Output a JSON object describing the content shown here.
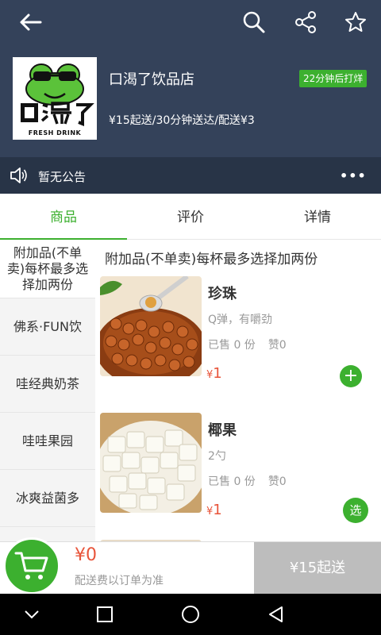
{
  "store": {
    "name": "口渴了饮品店",
    "badge": "22分钟后打烊",
    "info": "¥15起送/30分钟送达/配送¥3",
    "logo_icon": "frog-logo",
    "logo_caption": "FRESH DRINK"
  },
  "notice": {
    "text": "暂无公告",
    "more": "•••"
  },
  "tabs": [
    {
      "label": "商品",
      "active": true
    },
    {
      "label": "评价",
      "active": false
    },
    {
      "label": "详情",
      "active": false
    }
  ],
  "sidebar": {
    "items": [
      {
        "label": "附加品(不单卖)每杯最多选择加两份",
        "active": true
      },
      {
        "label": "佛系·FUN饮",
        "active": false
      },
      {
        "label": "哇经典奶茶",
        "active": false
      },
      {
        "label": "哇哇果园",
        "active": false
      },
      {
        "label": "冰爽益菌多",
        "active": false
      }
    ]
  },
  "content": {
    "category_title": "附加品(不单卖)每杯最多选择加两份",
    "products": [
      {
        "name": "珍珠",
        "desc": "Q弹，有嚼劲",
        "sold": "已售 0 份",
        "likes": "赞0",
        "currency": "¥",
        "price": "1",
        "action": "+"
      },
      {
        "name": "椰果",
        "desc": "2勺",
        "sold": "已售 0 份",
        "likes": "赞0",
        "currency": "¥",
        "price": "1",
        "action": "选"
      }
    ]
  },
  "cart": {
    "total": "¥0",
    "fee_note": "配送费以订单为准",
    "min_order": "¥15起送"
  },
  "colors": {
    "header": "#34425a",
    "notice_bar": "#283447",
    "accent_green": "#3cb02f",
    "price_red": "#e8543a"
  }
}
